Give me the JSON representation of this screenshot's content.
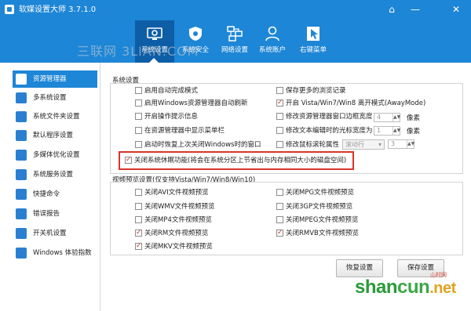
{
  "window": {
    "title": "软媒设置大师 3.7.1.0",
    "controls": [
      "⌂",
      "—",
      "✕"
    ]
  },
  "toolbar": {
    "watermark": "三联网 3LIAN.COM",
    "buttons": [
      {
        "label": "系统设置",
        "icon": "desktop-gear-icon",
        "active": true
      },
      {
        "label": "系统安全",
        "icon": "shield-icon",
        "active": false
      },
      {
        "label": "网络设置",
        "icon": "network-icon",
        "active": false
      },
      {
        "label": "系统账户",
        "icon": "user-icon",
        "active": false
      },
      {
        "label": "右键菜单",
        "icon": "cursor-icon",
        "active": false
      }
    ]
  },
  "sidebar": {
    "items": [
      {
        "label": "资源管理器",
        "icon": "folder-icon",
        "active": true
      },
      {
        "label": "多系统设置",
        "icon": "multi-system-icon"
      },
      {
        "label": "系统文件夹设置",
        "icon": "system-folder-icon"
      },
      {
        "label": "默认程序设置",
        "icon": "default-program-icon"
      },
      {
        "label": "多媒体优化设置",
        "icon": "media-icon"
      },
      {
        "label": "系统服务设置",
        "icon": "service-icon"
      },
      {
        "label": "快捷命令",
        "icon": "command-icon"
      },
      {
        "label": "错误报告",
        "icon": "error-report-icon"
      },
      {
        "label": "开关机设置",
        "icon": "power-icon"
      },
      {
        "label": "Windows 体验指数",
        "icon": "windows-score-icon"
      }
    ]
  },
  "system_settings": {
    "title": "系统设置",
    "left": [
      {
        "label": "启用自动完成模式",
        "checked": false
      },
      {
        "label": "启用Windows资源管理器自动刷新",
        "checked": false
      },
      {
        "label": "开启操作提示信息",
        "checked": false
      },
      {
        "label": "在资源管理器中显示菜单栏",
        "checked": false
      },
      {
        "label": "启动时恢复上次关闭Windows时的窗口",
        "checked": false
      },
      {
        "label": "关闭系统休眠功能(将会在系统分区上节省出与内存相同大小的磁盘空间)",
        "checked": true
      }
    ],
    "right": [
      {
        "label": "保存更多的浏览记录",
        "checked": false
      },
      {
        "label": "开启 Vista/Win7/Win8 离开模式(AwayMode)",
        "checked": true
      },
      {
        "label": "修改资源管理器窗口边框宽度",
        "checked": false,
        "value": "4",
        "unit": "像素"
      },
      {
        "label": "修改文本编辑时的光标宽度为",
        "checked": false,
        "value": "1",
        "unit": "像素"
      },
      {
        "label": "修改鼠标滚轮属性",
        "checked": false,
        "dropdown": "滚动行",
        "value": "3"
      }
    ]
  },
  "preview_settings": {
    "title": "视频预览设置(仅支持Vista/Win7/Win8/Win10)",
    "left": [
      {
        "label": "关闭AVI文件视频预览",
        "checked": false
      },
      {
        "label": "关闭WMV文件视频预览",
        "checked": false
      },
      {
        "label": "关闭MP4文件视频预览",
        "checked": false
      },
      {
        "label": "关闭RM文件视频预览",
        "checked": true
      },
      {
        "label": "关闭MKV文件视频预览",
        "checked": true
      }
    ],
    "right": [
      {
        "label": "关闭MPG文件视频预览",
        "checked": false
      },
      {
        "label": "关闭3GP文件视频预览",
        "checked": false
      },
      {
        "label": "关闭MPEG文件视频预览",
        "checked": false
      },
      {
        "label": "关闭RMVB文件视频预览",
        "checked": true
      }
    ]
  },
  "actions": {
    "restore": "恢复设置",
    "save": "保存设置"
  },
  "watermark": {
    "brand_left": "shan",
    "brand_right": "cun",
    "brand_tld": ".net",
    "small": "山村网"
  },
  "colors": {
    "accent": "#1e86d6",
    "accent_dark": "#0d5ea6",
    "highlight": "#d9342b",
    "check": "#c0392b"
  }
}
